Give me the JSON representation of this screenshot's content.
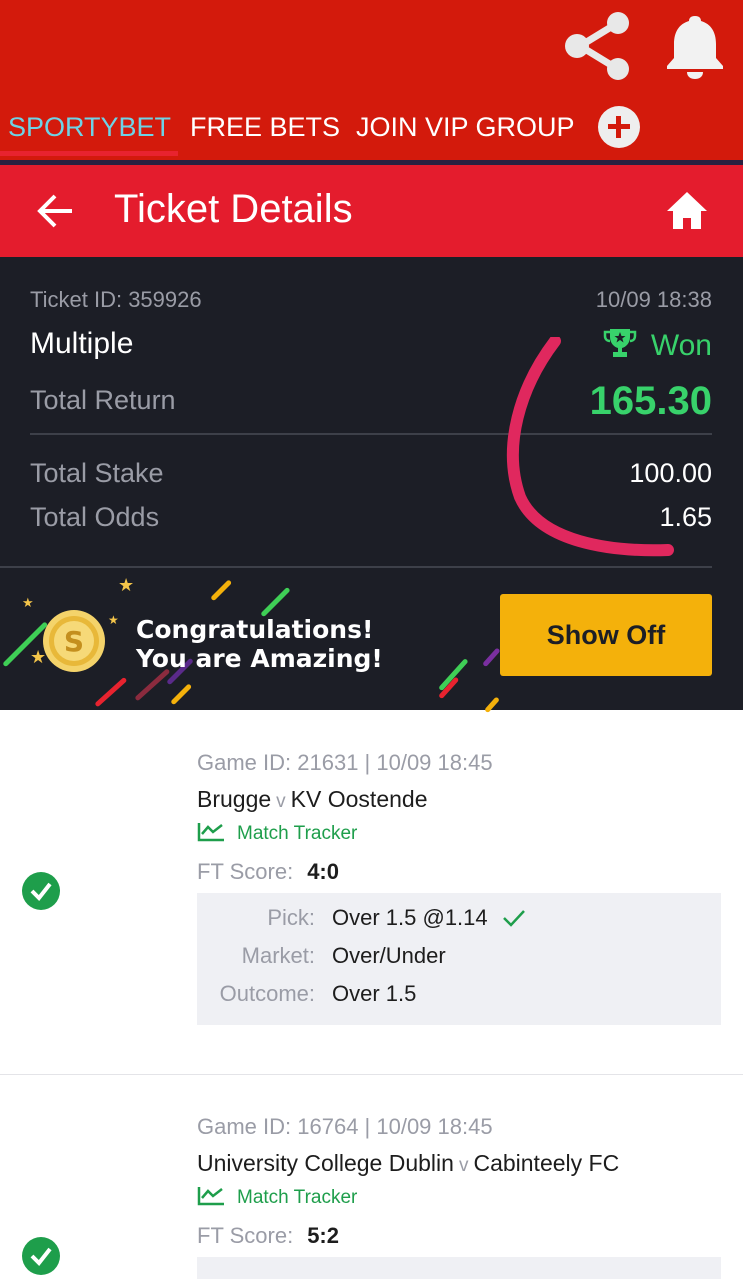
{
  "tabs": [
    {
      "label": "SPORTYBET",
      "active": true
    },
    {
      "label": "FREE BETS",
      "active": false
    },
    {
      "label": "JOIN VIP GROUP",
      "active": false
    }
  ],
  "header": {
    "title": "Ticket Details"
  },
  "ticket": {
    "id_text": "Ticket ID: 359926",
    "datetime": "10/09 18:38",
    "type": "Multiple",
    "status": "Won",
    "total_return_label": "Total Return",
    "total_return": "165.30",
    "total_stake_label": "Total Stake",
    "total_stake": "100.00",
    "total_odds_label": "Total Odds",
    "total_odds": "1.65"
  },
  "banner": {
    "line1": "Congratulations!",
    "line2": "You are Amazing!",
    "button_label": "Show Off"
  },
  "selections": [
    {
      "game_info": "Game ID: 21631 | 10/09 18:45",
      "home": "Brugge",
      "vs": "v",
      "away": "KV Oostende",
      "tracker_label": "Match Tracker",
      "ft_label": "FT Score:",
      "ft_score": "4:0",
      "pick_label": "Pick:",
      "pick": "Over 1.5 @1.14",
      "market_label": "Market:",
      "market": "Over/Under",
      "outcome_label": "Outcome:",
      "outcome": "Over 1.5",
      "won": true
    },
    {
      "game_info": "Game ID: 16764 | 10/09 18:45",
      "home": "University College Dublin",
      "vs": "v",
      "away": "Cabinteely FC",
      "tracker_label": "Match Tracker",
      "ft_label": "FT Score:",
      "ft_score": "5:2",
      "won": true
    }
  ],
  "colors": {
    "topbar": "#d31a0c",
    "header": "#e41c2d",
    "panel": "#1c1e26",
    "won_green": "#38d26b",
    "accent_green": "#1e9e4b",
    "button_yellow": "#f4b10b",
    "active_tab": "#6ed3e6"
  }
}
